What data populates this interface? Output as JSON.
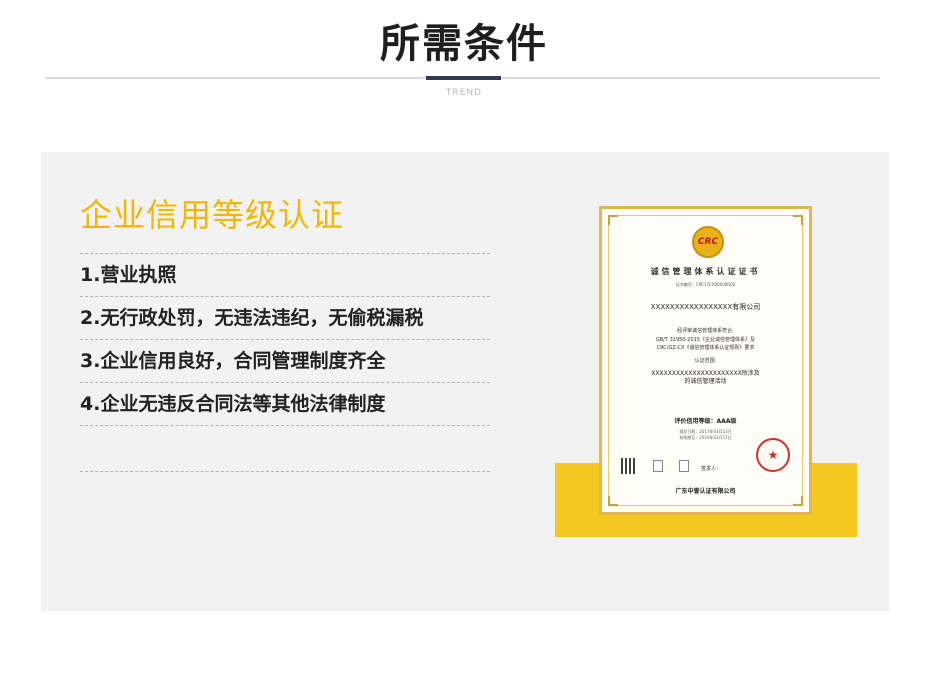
{
  "header": {
    "title": "所需条件",
    "subtitle": "TREND"
  },
  "section": {
    "heading": "企业信用等级认证",
    "requirements": [
      "1.营业执照",
      "2.无行政处罚，无违法违纪，无偷税漏税",
      "3.企业信用良好，合同管理制度齐全",
      "4.企业无违反合同法等其他法律制度"
    ]
  },
  "certificate": {
    "logo_text": "CRC",
    "title": "诚信管理体系认证证书",
    "cert_no": "证书编号：CRC17CX00000R0S",
    "company": "XXXXXXXXXXXXXXXXX有限公司",
    "std_intro": "经评审诚信管理体系符合:",
    "std_1": "GB/T 31950-2015《企业诚信管理体系》及",
    "std_2": "CRC/GZ-CX《诚信管理体系认证规则》要求",
    "scope_label": "认证范围:",
    "scope_1": "XXXXXXXXXXXXXXXXXXXXXX所涉及",
    "scope_2": "的诚信管理活动",
    "grade": "评价信用等级：AAA级",
    "date_1": "颁发日期：2017年03月13日",
    "date_2": "有效期至：2020年03月12日",
    "sign": "签发人：",
    "issuer": "广东中誉认证有限公司"
  },
  "colors": {
    "accent_yellow": "#f2b705",
    "block_yellow": "#f4c820",
    "title_accent": "#2f3b52",
    "panel_bg": "#f2f2f2"
  }
}
